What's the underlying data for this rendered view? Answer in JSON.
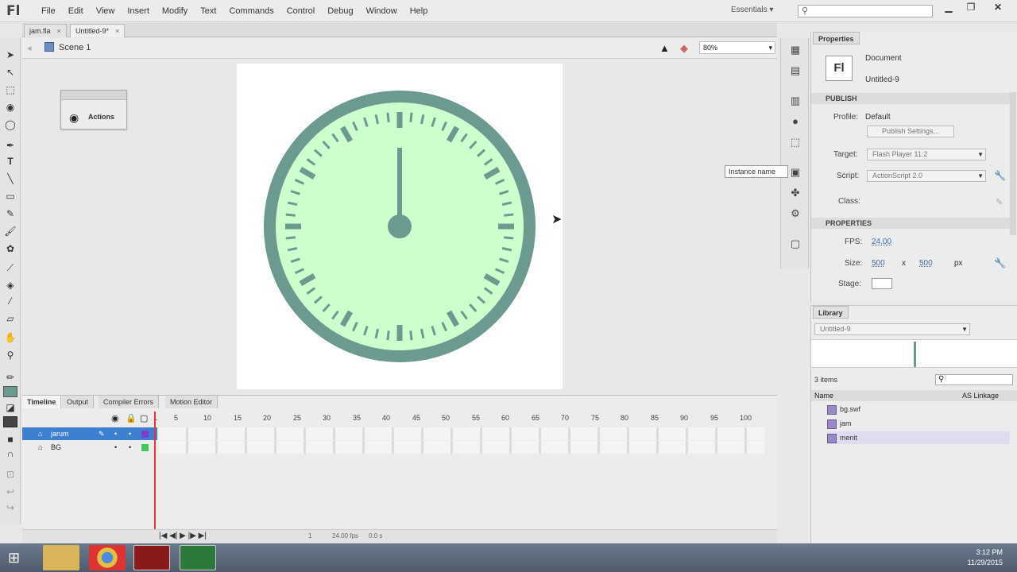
{
  "app": {
    "logo": "Fl",
    "workspace": "Essentials",
    "search_glyph": "⚲"
  },
  "menu": [
    "File",
    "Edit",
    "View",
    "Insert",
    "Modify",
    "Text",
    "Commands",
    "Control",
    "Debug",
    "Window",
    "Help"
  ],
  "doc_tabs": [
    {
      "label": "jam.fla",
      "close": "×"
    },
    {
      "label": "Untitled-9*",
      "close": "×"
    }
  ],
  "edit_bar": {
    "scene": "Scene 1",
    "zoom": "80%"
  },
  "floating_panel": {
    "label": "Actions"
  },
  "tooltip": "Instance name",
  "properties": {
    "tab": "Properties",
    "doc_icon": "Fl",
    "doc_type": "Document",
    "doc_name": "Untitled-9",
    "publish_header": "PUBLISH",
    "profile_label": "Profile:",
    "profile_value": "Default",
    "publish_settings": "Publish Settings...",
    "target_label": "Target:",
    "target_value": "Flash Player 11.2",
    "script_label": "Script:",
    "script_value": "ActionScript 2.0",
    "class_label": "Class:",
    "properties_header": "PROPERTIES",
    "fps_label": "FPS:",
    "fps_value": "24.00",
    "size_label": "Size:",
    "width": "500",
    "x": "x",
    "height": "500",
    "unit": "px",
    "stage_label": "Stage:"
  },
  "library": {
    "tab": "Library",
    "doc": "Untitled-9",
    "count": "3 items",
    "col_name": "Name",
    "col_linkage": "AS Linkage",
    "items": [
      "bg.swf",
      "jam",
      "menit"
    ]
  },
  "timeline": {
    "tabs": [
      "Timeline",
      "Output",
      "Compiler Errors",
      "Motion Editor"
    ],
    "frames": [
      "1",
      "5",
      "10",
      "15",
      "20",
      "25",
      "30",
      "35",
      "40",
      "45",
      "50",
      "55",
      "60",
      "65",
      "70",
      "75",
      "80",
      "85",
      "90",
      "95",
      "100"
    ],
    "layers": [
      {
        "name": "jarum",
        "dot1": "•",
        "dot2": "•"
      },
      {
        "name": "BG",
        "dot1": "•",
        "dot2": "•"
      }
    ],
    "status": {
      "frame": "1",
      "fps": "24.00 fps",
      "time": "0.0 s"
    }
  },
  "taskbar": {
    "time": "3:12 PM",
    "date": "11/29/2015"
  },
  "colors": {
    "clock_ring": "#6a9a90",
    "clock_face": "#ccffcc",
    "stage": "#ffffff",
    "selection": "#3d7fd1"
  }
}
